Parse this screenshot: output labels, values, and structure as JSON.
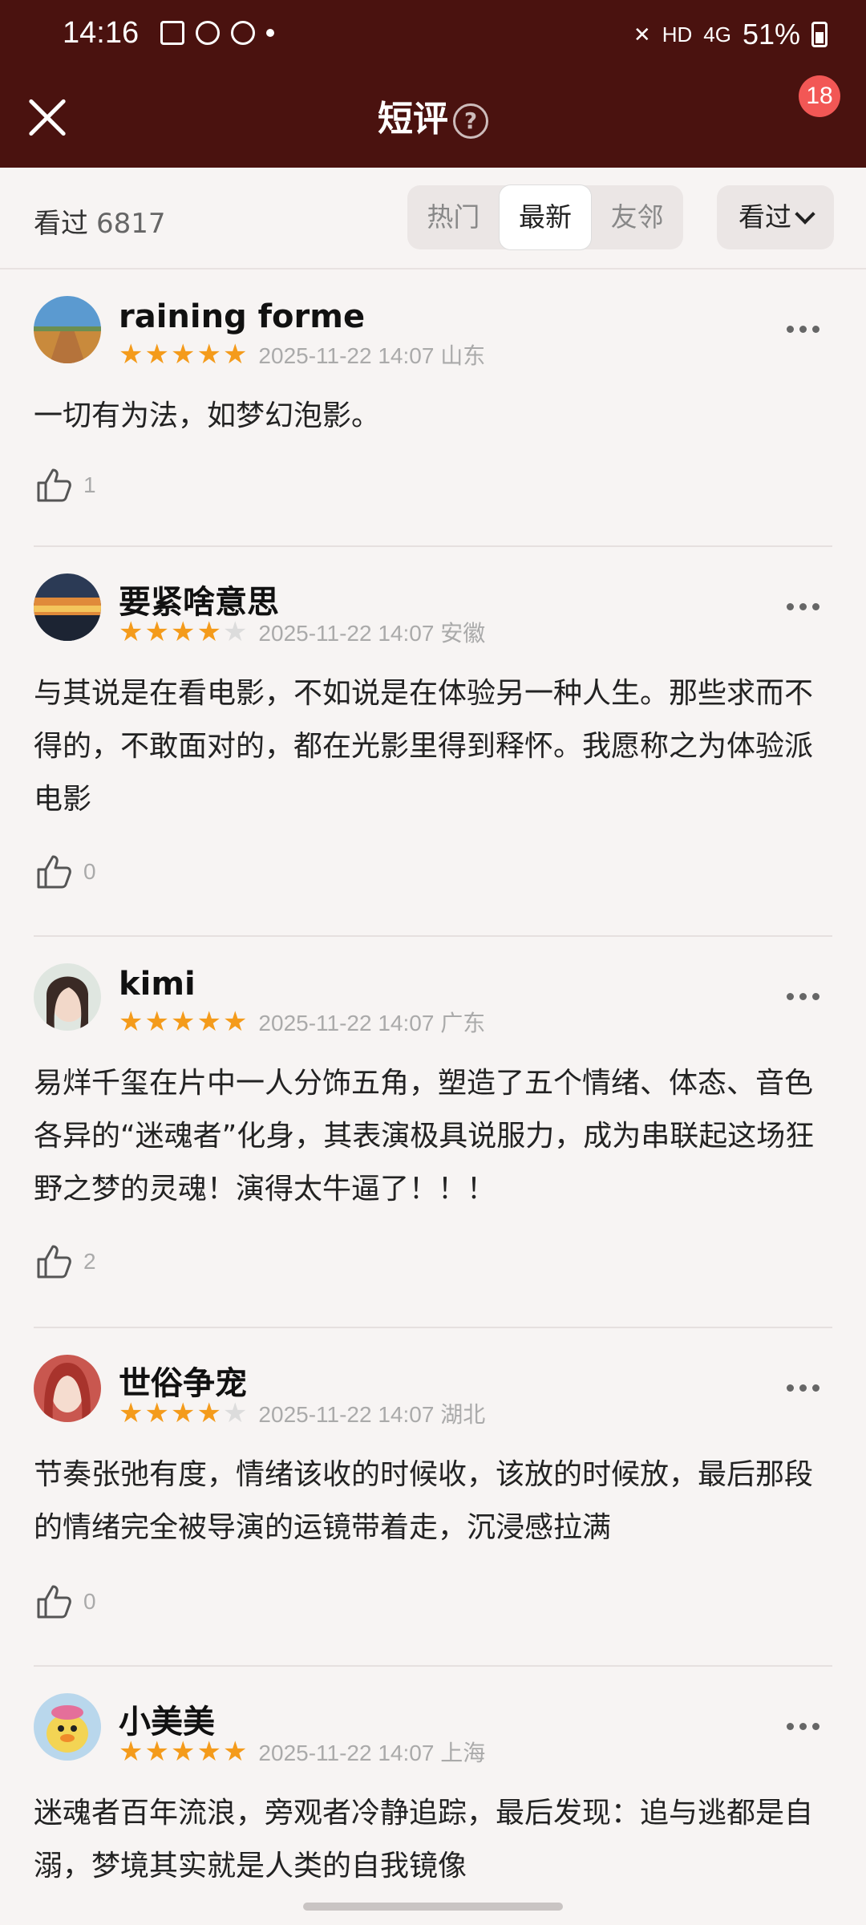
{
  "status": {
    "time": "14:16",
    "battery": "51%",
    "hd": "HD",
    "net": "4G"
  },
  "header": {
    "title": "短评",
    "help": "?",
    "badge": "18"
  },
  "filter": {
    "seen_label": "看过",
    "seen_count": "6817",
    "tabs": [
      {
        "label": "热门"
      },
      {
        "label": "最新"
      },
      {
        "label": "友邻"
      }
    ],
    "active_tab": "最新",
    "dropdown": "看过"
  },
  "comments": [
    {
      "user": "raining forme",
      "rating": 5,
      "date": "2025-11-22 14:07 山东",
      "text": "一切有为法，如梦幻泡影。",
      "likes": "1"
    },
    {
      "user": "要紧啥意思",
      "rating": 4,
      "date": "2025-11-22 14:07 安徽",
      "text": "与其说是在看电影，不如说是在体验另一种人生。那些求而不得的，不敢面对的，都在光影里得到释怀。我愿称之为体验派电影",
      "likes": "0"
    },
    {
      "user": "kimi",
      "rating": 5,
      "date": "2025-11-22 14:07 广东",
      "text": "易烊千玺在片中一人分饰五角，塑造了五个情绪、体态、音色各异的“迷魂者”化身，其表演极具说服力，成为串联起这场狂野之梦的灵魂！演得太牛逼了！！！",
      "likes": "2"
    },
    {
      "user": "世俗争宠",
      "rating": 4,
      "date": "2025-11-22 14:07 湖北",
      "text": "节奏张弛有度，情绪该收的时候收，该放的时候放，最后那段的情绪完全被导演的运镜带着走，沉浸感拉满",
      "likes": "0"
    },
    {
      "user": "小美美",
      "rating": 5,
      "date": "2025-11-22 14:07 上海",
      "text": "迷魂者百年流浪，旁观者冷静追踪，最后发现：追与逃都是自溺，梦境其实就是人类的自我镜像",
      "likes": ""
    }
  ]
}
